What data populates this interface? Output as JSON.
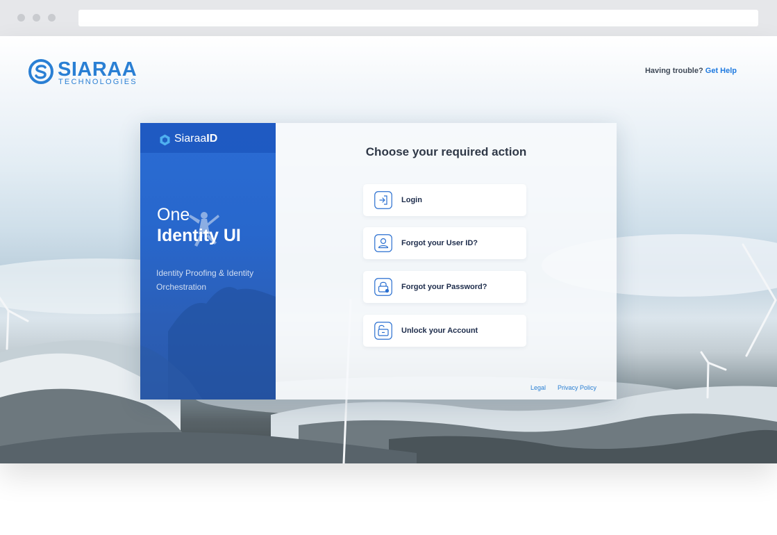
{
  "brand": {
    "logo_word": "SIARAA",
    "logo_sub": "TECHNOLOGIES",
    "accent_color": "#2a7fd4"
  },
  "header": {
    "help_prefix": "Having trouble?",
    "help_link": "Get Help"
  },
  "left_panel": {
    "product_prefix": "Siaraa",
    "product_suffix": "ID",
    "headline_line1": "One",
    "headline_line2": "Identity UI",
    "tagline": "Identity Proofing & Identity Orchestration",
    "color": "#2a6cd4"
  },
  "main": {
    "heading": "Choose your required action",
    "actions": [
      {
        "label": "Login",
        "icon": "login-icon"
      },
      {
        "label": "Forgot your User ID?",
        "icon": "user-icon"
      },
      {
        "label": "Forgot your Password?",
        "icon": "lock-icon"
      },
      {
        "label": "Unlock your Account",
        "icon": "unlock-icon"
      }
    ]
  },
  "footer": {
    "legal": "Legal",
    "privacy": "Privacy Policy"
  }
}
